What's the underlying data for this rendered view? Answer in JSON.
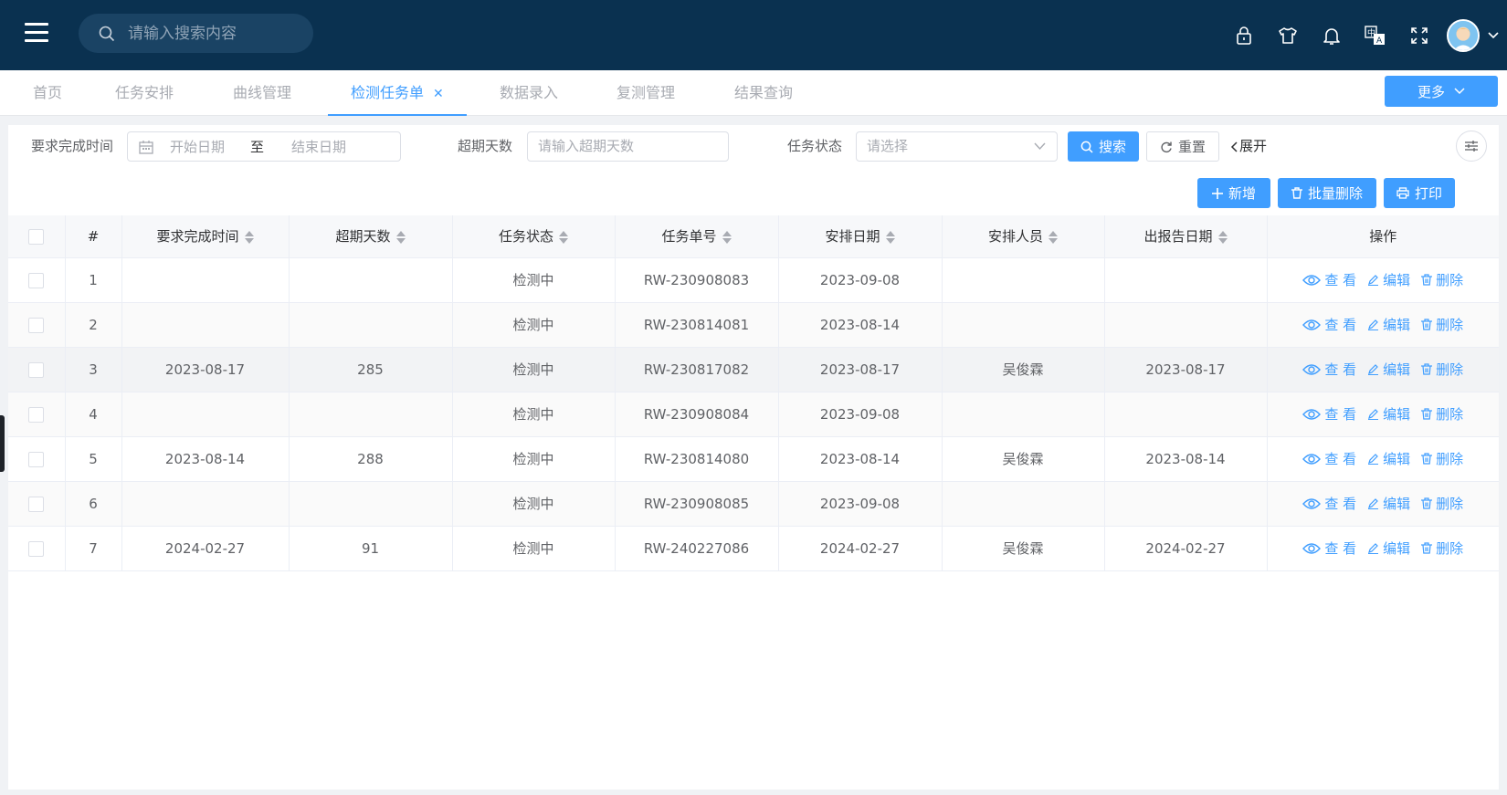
{
  "header": {
    "search_placeholder": "请输入搜索内容",
    "icons": [
      "lock-icon",
      "shirt-icon",
      "bell-icon",
      "translate-icon",
      "fullscreen-icon"
    ]
  },
  "tabs": [
    {
      "label": "首页",
      "active": false
    },
    {
      "label": "任务安排",
      "active": false
    },
    {
      "label": "曲线管理",
      "active": false
    },
    {
      "label": "检测任务单",
      "active": true
    },
    {
      "label": "数据录入",
      "active": false
    },
    {
      "label": "复测管理",
      "active": false
    },
    {
      "label": "结果查询",
      "active": false
    }
  ],
  "more_label": "更多",
  "filters": {
    "due_time_label": "要求完成时间",
    "start_placeholder": "开始日期",
    "range_sep": "至",
    "end_placeholder": "结束日期",
    "overdue_label": "超期天数",
    "overdue_placeholder": "请输入超期天数",
    "status_label": "任务状态",
    "status_placeholder": "请选择",
    "search_label": "搜索",
    "reset_label": "重置",
    "expand_label": "展开"
  },
  "actions": {
    "add_label": "新增",
    "batch_delete_label": "批量删除",
    "print_label": "打印"
  },
  "table": {
    "columns": [
      "#",
      "要求完成时间",
      "超期天数",
      "任务状态",
      "任务单号",
      "安排日期",
      "安排人员",
      "出报告日期",
      "操作"
    ],
    "op_labels": {
      "view": "查 看",
      "edit": "编辑",
      "delete": "删除"
    },
    "rows": [
      {
        "idx": "1",
        "due": "",
        "overdue": "",
        "status": "检测中",
        "no": "RW-230908083",
        "date": "2023-09-08",
        "person": "",
        "report": ""
      },
      {
        "idx": "2",
        "due": "",
        "overdue": "",
        "status": "检测中",
        "no": "RW-230814081",
        "date": "2023-08-14",
        "person": "",
        "report": ""
      },
      {
        "idx": "3",
        "due": "2023-08-17",
        "overdue": "285",
        "status": "检测中",
        "no": "RW-230817082",
        "date": "2023-08-17",
        "person": "吴俊霖",
        "report": "2023-08-17"
      },
      {
        "idx": "4",
        "due": "",
        "overdue": "",
        "status": "检测中",
        "no": "RW-230908084",
        "date": "2023-09-08",
        "person": "",
        "report": ""
      },
      {
        "idx": "5",
        "due": "2023-08-14",
        "overdue": "288",
        "status": "检测中",
        "no": "RW-230814080",
        "date": "2023-08-14",
        "person": "吴俊霖",
        "report": "2023-08-14"
      },
      {
        "idx": "6",
        "due": "",
        "overdue": "",
        "status": "检测中",
        "no": "RW-230908085",
        "date": "2023-09-08",
        "person": "",
        "report": ""
      },
      {
        "idx": "7",
        "due": "2024-02-27",
        "overdue": "91",
        "status": "检测中",
        "no": "RW-240227086",
        "date": "2024-02-27",
        "person": "吴俊霖",
        "report": "2024-02-27"
      }
    ]
  },
  "colors": {
    "accent": "#409eff",
    "header_bg": "#0a3150"
  }
}
